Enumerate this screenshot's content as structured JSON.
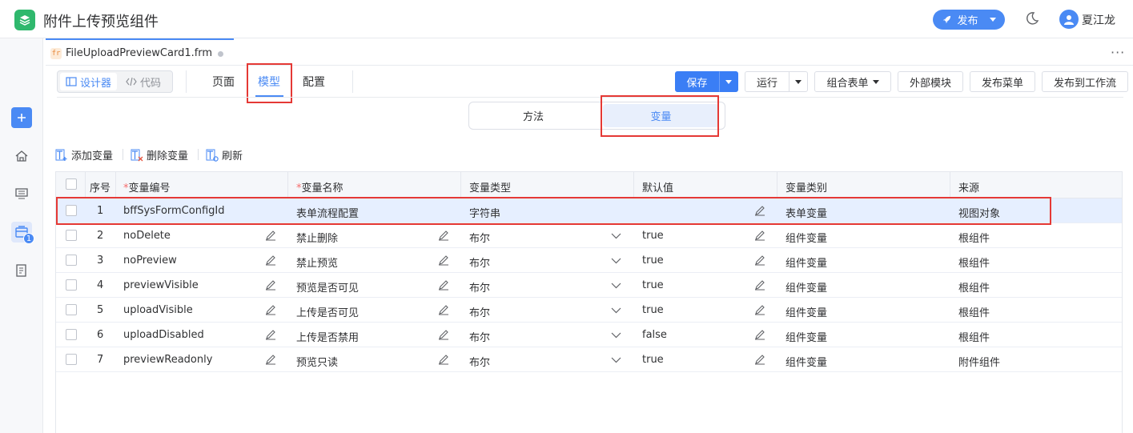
{
  "header": {
    "title": "附件上传预览组件",
    "publish_label": "发布",
    "user_name": "夏江龙"
  },
  "leftrail": {
    "badge_count": "1"
  },
  "file_tab": {
    "icon_text": "fr",
    "filename": "FileUploadPreviewCard1.frm",
    "more": "···"
  },
  "toolbar": {
    "designer_label": "设计器",
    "code_label": "代码",
    "tabs": [
      "页面",
      "模型",
      "配置"
    ],
    "save_label": "保存",
    "run_label": "运行",
    "combo_form_label": "组合表单",
    "external_module_label": "外部模块",
    "publish_menu_label": "发布菜单",
    "publish_workflow_label": "发布到工作流"
  },
  "switch": {
    "method_label": "方法",
    "variable_label": "变量"
  },
  "actions": {
    "add_label": "添加变量",
    "delete_label": "删除变量",
    "refresh_label": "刷新"
  },
  "table": {
    "headers": {
      "index": "序号",
      "code": "变量编号",
      "name": "变量名称",
      "type": "变量类型",
      "default": "默认值",
      "category": "变量类别",
      "source": "来源"
    },
    "rows": [
      {
        "index": "1",
        "code": "bffSysFormConfigId",
        "name": "表单流程配置",
        "type": "字符串",
        "default": "",
        "category": "表单变量",
        "source": "视图对象"
      },
      {
        "index": "2",
        "code": "noDelete",
        "name": "禁止删除",
        "type": "布尔",
        "default": "true",
        "category": "组件变量",
        "source": "根组件"
      },
      {
        "index": "3",
        "code": "noPreview",
        "name": "禁止预览",
        "type": "布尔",
        "default": "true",
        "category": "组件变量",
        "source": "根组件"
      },
      {
        "index": "4",
        "code": "previewVisible",
        "name": "预览是否可见",
        "type": "布尔",
        "default": "true",
        "category": "组件变量",
        "source": "根组件"
      },
      {
        "index": "5",
        "code": "uploadVisible",
        "name": "上传是否可见",
        "type": "布尔",
        "default": "true",
        "category": "组件变量",
        "source": "根组件"
      },
      {
        "index": "6",
        "code": "uploadDisabled",
        "name": "上传是否禁用",
        "type": "布尔",
        "default": "false",
        "category": "组件变量",
        "source": "根组件"
      },
      {
        "index": "7",
        "code": "previewReadonly",
        "name": "预览只读",
        "type": "布尔",
        "default": "true",
        "category": "组件变量",
        "source": "附件组件"
      }
    ]
  },
  "colors": {
    "accent": "#4a8af4",
    "primary_button": "#3a7ef5",
    "highlight_box": "#e53935",
    "selected_row": "#e6efff",
    "logo": "#2fb86d"
  }
}
